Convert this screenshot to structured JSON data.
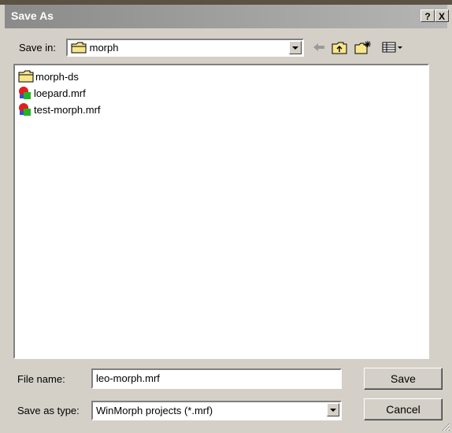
{
  "window": {
    "title": "Save As",
    "help_label": "?",
    "close_label": "X"
  },
  "toolbar": {
    "save_in_label": "Save in:",
    "location": "morph",
    "icons": [
      "back-arrow-icon",
      "up-folder-icon",
      "new-folder-icon",
      "view-menu-icon"
    ]
  },
  "files": [
    {
      "name": "morph-ds",
      "icon": "folder-icon"
    },
    {
      "name": "loepard.mrf",
      "icon": "winmorph-file-icon"
    },
    {
      "name": "test-morph.mrf",
      "icon": "winmorph-file-icon"
    }
  ],
  "form": {
    "file_name_label": "File name:",
    "file_name_value": "leo-morph.mrf",
    "save_type_label": "Save as type:",
    "save_type_value": "WinMorph projects (*.mrf)"
  },
  "buttons": {
    "save": "Save",
    "cancel": "Cancel"
  }
}
